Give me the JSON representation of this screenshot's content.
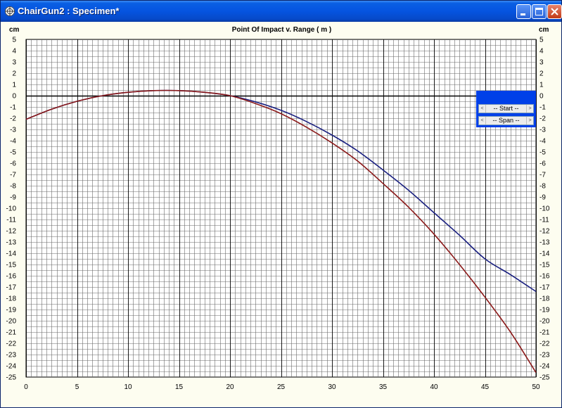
{
  "window": {
    "title": "ChairGun2 : Specimen*",
    "buttons": {
      "minimize": "minimize",
      "maximize": "maximize",
      "close": "close"
    }
  },
  "chart": {
    "title": "Point Of Impact v. Range ( m )",
    "left_unit": "cm",
    "right_unit": "cm"
  },
  "controls": {
    "start_label": "-- Start --",
    "span_label": "-- Span --",
    "left_arrow": "<",
    "right_arrow": ">"
  },
  "colors": {
    "titlebar": "#0554e0",
    "plot_background": "#fdfdf0",
    "grid": "#000000",
    "series_1": "#1a2080",
    "series_2": "#8b1a1a",
    "control_panel": "#0040e8"
  },
  "chart_data": {
    "type": "line",
    "title": "Point Of Impact v. Range ( m )",
    "xlabel": "",
    "ylabel": "cm",
    "xlim": [
      0,
      50
    ],
    "ylim": [
      -25,
      5
    ],
    "x_ticks": [
      0,
      5,
      10,
      15,
      20,
      25,
      30,
      35,
      40,
      45,
      50
    ],
    "y_ticks": [
      5,
      4,
      3,
      2,
      1,
      0,
      -1,
      -2,
      -3,
      -4,
      -5,
      -6,
      -7,
      -8,
      -9,
      -10,
      -11,
      -12,
      -13,
      -14,
      -15,
      -16,
      -17,
      -18,
      -19,
      -20,
      -21,
      -22,
      -23,
      -24,
      -25
    ],
    "grid": true,
    "series": [
      {
        "color": "#1a2080",
        "x": [
          0,
          2.5,
          5,
          7.5,
          10,
          12.5,
          15,
          17.5,
          20,
          22.5,
          25,
          27.5,
          30,
          32.5,
          35,
          37.5,
          40,
          42.5,
          45,
          47.5,
          50
        ],
        "y": [
          -2.1,
          -1.2,
          -0.5,
          0.0,
          0.3,
          0.45,
          0.45,
          0.3,
          0.0,
          -0.55,
          -1.3,
          -2.3,
          -3.5,
          -4.9,
          -6.6,
          -8.4,
          -10.4,
          -12.4,
          -14.5,
          -15.9,
          -17.4
        ]
      },
      {
        "color": "#8b1a1a",
        "x": [
          0,
          2.5,
          5,
          7.5,
          10,
          12.5,
          15,
          17.5,
          20,
          22.5,
          25,
          27.5,
          30,
          32.5,
          35,
          37.5,
          40,
          42.5,
          45,
          47.5,
          50
        ],
        "y": [
          -2.1,
          -1.2,
          -0.5,
          0.0,
          0.3,
          0.45,
          0.45,
          0.3,
          0.0,
          -0.7,
          -1.6,
          -2.8,
          -4.2,
          -5.8,
          -7.8,
          -9.9,
          -12.3,
          -15.0,
          -17.9,
          -21.0,
          -24.6
        ]
      }
    ]
  }
}
